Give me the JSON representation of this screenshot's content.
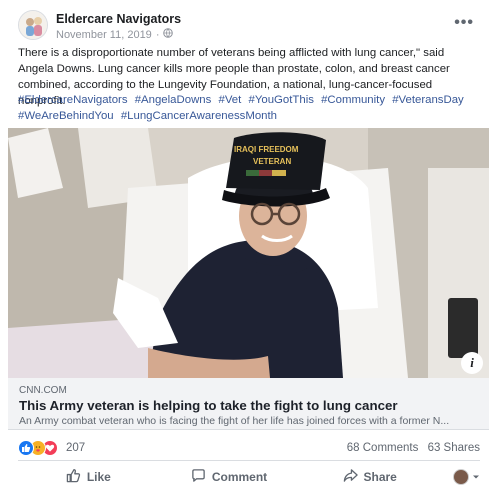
{
  "post": {
    "author": "Eldercare Navigators",
    "date": "November 11, 2019",
    "date_separator": "·",
    "more_label": "•••",
    "text": "There is a disproportionate number of veterans being afflicted with lung cancer,\" said Angela Downs. Lung cancer kills more people than prostate, colon, and breast cancer combined, according to the Lungevity Foundation, a national, lung-cancer-focused nonprofit.",
    "hashtags": [
      "#EldercareNavigators",
      "#AngelaDowns",
      "#Vet",
      "#YouGotThis",
      "#Community",
      "#VeteransDay",
      "#WeAreBehindYou",
      "#LungCancerAwarenessMonth"
    ]
  },
  "photo": {
    "cap_text_line1": "IRAQI FREEDOM",
    "cap_text_line2": "VETERAN",
    "info_label": "i"
  },
  "link": {
    "domain": "CNN.COM",
    "title": "This Army veteran is helping to take the fight to lung cancer",
    "description": "An Army combat veteran who is facing the fight of her life has joined forces with a former N..."
  },
  "engagement": {
    "reaction_count": "207",
    "comments": "68 Comments",
    "shares": "63 Shares",
    "reactions": [
      "like",
      "care",
      "love"
    ]
  },
  "actions": {
    "like": "Like",
    "comment": "Comment",
    "share": "Share"
  },
  "colors": {
    "link_blue": "#385898",
    "like_blue": "#1877f2",
    "love_red": "#f33e58",
    "care_yellow": "#f7b125"
  }
}
